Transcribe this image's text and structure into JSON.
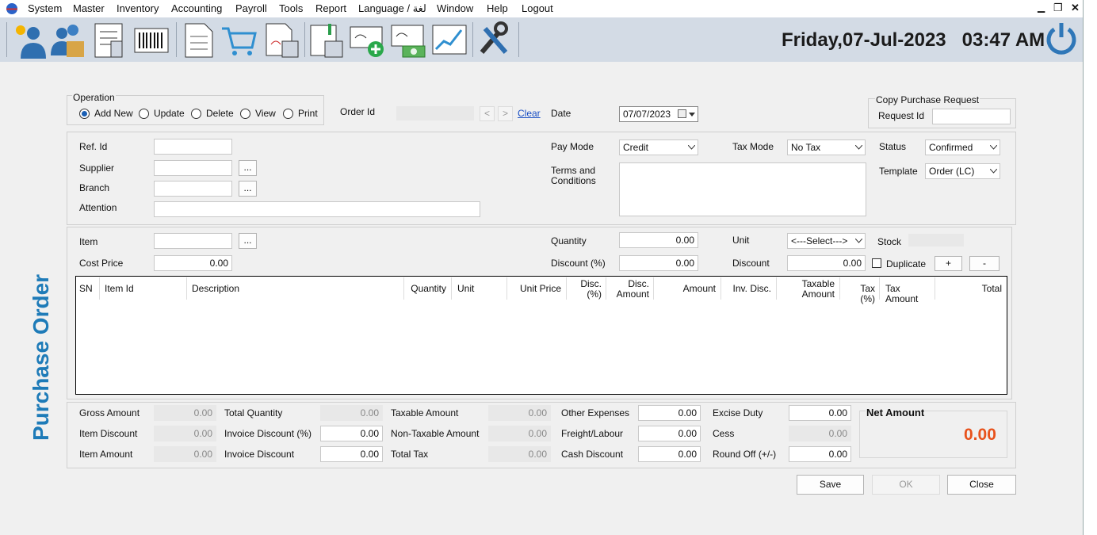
{
  "menu": [
    "System",
    "Master",
    "Inventory",
    "Accounting",
    "Payroll",
    "Tools",
    "Report",
    "Language / لغة",
    "Window",
    "Help",
    "Logout"
  ],
  "window_controls": {
    "minimize": "▁",
    "restore": "❐",
    "close": "✕"
  },
  "toolbar": {
    "icons": [
      "user-settings-icon",
      "users-icon",
      "document-list-icon",
      "barcode-icon",
      "invoice-icon",
      "shopping-cart-icon",
      "purchase-sheet-icon",
      "ledger-icon",
      "cheque-add-icon",
      "cheque-cash-icon",
      "chart-growth-icon",
      "tools-icon"
    ],
    "clock": "Friday,07-Jul-2023   03:47 AM",
    "power_icon": "power-icon"
  },
  "page_title": "Purchase Order",
  "operation": {
    "title": "Operation",
    "options": [
      "Add New",
      "Update",
      "Delete",
      "View",
      "Print"
    ],
    "selected": "Add New"
  },
  "order": {
    "label": "Order Id",
    "value": "",
    "prev": "<",
    "next": ">",
    "clear": "Clear"
  },
  "date": {
    "label": "Date",
    "value": "07/07/2023"
  },
  "copy_request": {
    "title": "Copy Purchase Request",
    "label": "Request Id",
    "value": ""
  },
  "header": {
    "ref_label": "Ref. Id",
    "supplier_label": "Supplier",
    "branch_label": "Branch",
    "attention_label": "Attention",
    "browse": "...",
    "pay_mode_label": "Pay Mode",
    "pay_mode": "Credit",
    "tax_mode_label": "Tax Mode",
    "tax_mode": "No Tax",
    "status_label": "Status",
    "status": "Confirmed",
    "terms_label": "Terms and\nConditions",
    "template_label": "Template",
    "template": "Order (LC)"
  },
  "item_entry": {
    "item_label": "Item",
    "cost_label": "Cost Price",
    "cost": "0.00",
    "qty_label": "Quantity",
    "qty": "0.00",
    "disc_pct_label": "Discount (%)",
    "disc_pct": "0.00",
    "unit_label": "Unit",
    "unit": "<---Select--->",
    "stock_label": "Stock",
    "discount_label": "Discount",
    "discount": "0.00",
    "duplicate_label": "Duplicate",
    "plus": "+",
    "minus": "-"
  },
  "grid": {
    "columns": [
      "SN",
      "Item Id",
      "Description",
      "Quantity",
      "Unit",
      "Unit Price",
      "Disc.\n(%)",
      "Disc.\nAmount",
      "Amount",
      "Inv. Disc.",
      "Taxable\nAmount",
      "Tax (%)",
      "Tax Amount",
      "Total"
    ]
  },
  "totals": {
    "gross_amount_label": "Gross Amount",
    "gross_amount": "0.00",
    "item_discount_label": "Item Discount",
    "item_discount": "0.00",
    "item_amount_label": "Item Amount",
    "item_amount": "0.00",
    "total_qty_label": "Total Quantity",
    "total_qty": "0.00",
    "inv_disc_pct_label": "Invoice Discount (%)",
    "inv_disc_pct": "0.00",
    "inv_disc_label": "Invoice Discount",
    "inv_disc": "0.00",
    "taxable_label": "Taxable Amount",
    "taxable": "0.00",
    "nontaxable_label": "Non-Taxable Amount",
    "nontaxable": "0.00",
    "total_tax_label": "Total Tax",
    "total_tax": "0.00",
    "other_exp_label": "Other Expenses",
    "other_exp": "0.00",
    "freight_label": "Freight/Labour",
    "freight": "0.00",
    "cash_disc_label": "Cash Discount",
    "cash_disc": "0.00",
    "excise_label": "Excise Duty",
    "excise": "0.00",
    "cess_label": "Cess",
    "cess": "0.00",
    "roundoff_label": "Round Off (+/-)",
    "roundoff": "0.00",
    "net_label": "Net Amount",
    "net": "0.00"
  },
  "actions": {
    "save": "Save",
    "ok": "OK",
    "close": "Close"
  },
  "colors": {
    "accent": "#1e7bb8",
    "net_amount": "#e8521c",
    "toolbar_bg": "#d3dbe5"
  }
}
